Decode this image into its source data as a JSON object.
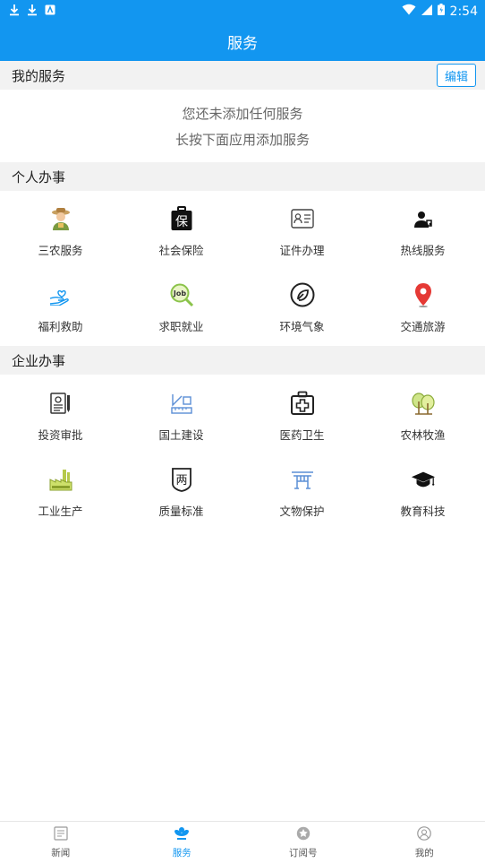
{
  "status_bar": {
    "time": "2:54"
  },
  "header": {
    "title": "服务"
  },
  "my_services": {
    "title": "我的服务",
    "edit_label": "编辑",
    "empty_line1": "您还未添加任何服务",
    "empty_line2": "长按下面应用添加服务"
  },
  "personal": {
    "title": "个人办事",
    "items": [
      {
        "label": "三农服务",
        "icon": "farmer-icon"
      },
      {
        "label": "社会保险",
        "icon": "insurance-icon"
      },
      {
        "label": "证件办理",
        "icon": "id-card-icon"
      },
      {
        "label": "热线服务",
        "icon": "hotline-icon"
      },
      {
        "label": "福利救助",
        "icon": "welfare-icon"
      },
      {
        "label": "求职就业",
        "icon": "job-search-icon"
      },
      {
        "label": "环境气象",
        "icon": "leaf-icon"
      },
      {
        "label": "交通旅游",
        "icon": "location-pin-icon"
      }
    ]
  },
  "enterprise": {
    "title": "企业办事",
    "items": [
      {
        "label": "投资审批",
        "icon": "investment-icon"
      },
      {
        "label": "国土建设",
        "icon": "land-ruler-icon"
      },
      {
        "label": "医药卫生",
        "icon": "medical-kit-icon"
      },
      {
        "label": "农林牧渔",
        "icon": "trees-icon"
      },
      {
        "label": "工业生产",
        "icon": "factory-icon"
      },
      {
        "label": "质量标准",
        "icon": "quality-badge-icon"
      },
      {
        "label": "文物保护",
        "icon": "heritage-icon"
      },
      {
        "label": "教育科技",
        "icon": "graduation-cap-icon"
      }
    ]
  },
  "tabs": [
    {
      "label": "新闻",
      "icon": "news-icon"
    },
    {
      "label": "服务",
      "icon": "services-icon"
    },
    {
      "label": "订阅号",
      "icon": "subscription-icon"
    },
    {
      "label": "我的",
      "icon": "profile-icon"
    }
  ],
  "colors": {
    "accent": "#1296f0",
    "section_bg": "#f2f2f2"
  }
}
